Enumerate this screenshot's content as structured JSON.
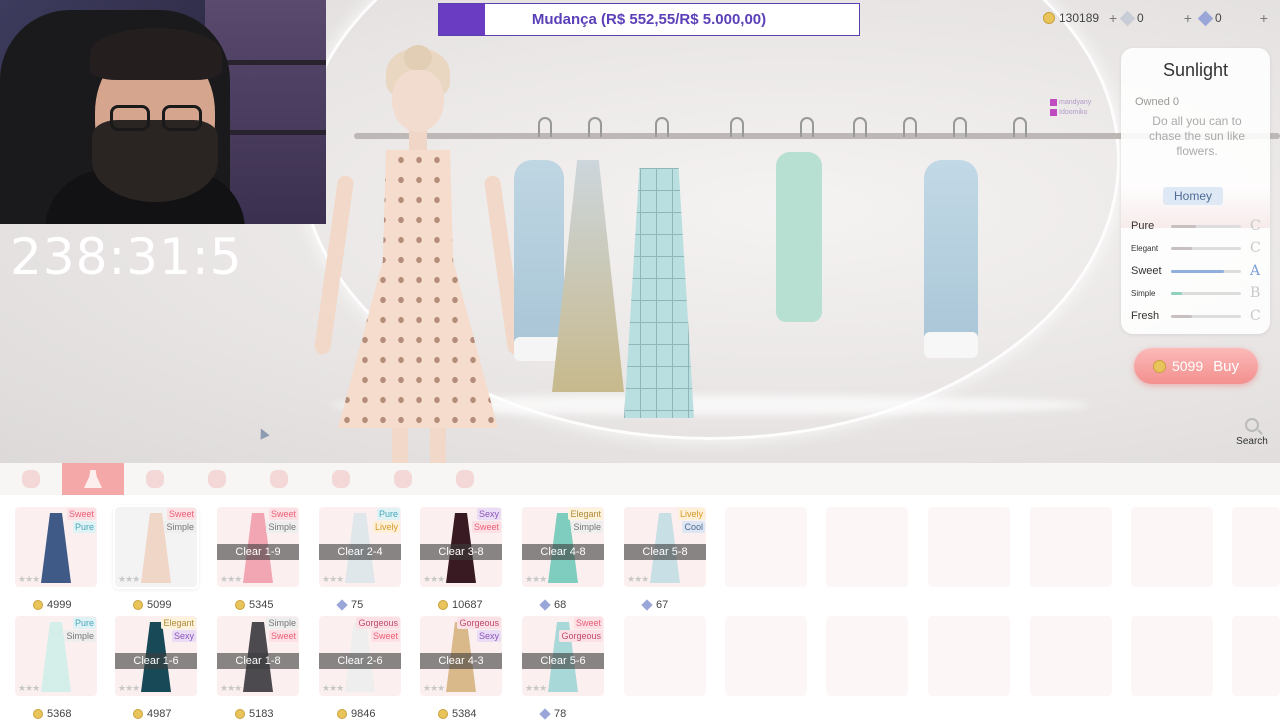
{
  "stream": {
    "timer": "238:31:5",
    "donation": {
      "label": "Mudança (R$ 552,55/R$ 5.000,00)",
      "progress": 0.1105,
      "color": "#6a3cc2"
    }
  },
  "currency": {
    "coins": "130189",
    "stamina": "0",
    "diamonds": "0"
  },
  "chat_overlay": [
    "mandyany",
    "Idoomiko"
  ],
  "card": {
    "title": "Sunlight",
    "owned": "Owned 0",
    "description": "Do all you can to chase the sun like flowers.",
    "style_tag": "Homey",
    "attributes": [
      {
        "name": "Pure",
        "grade": "C",
        "level": 0.35
      },
      {
        "name": "Elegant",
        "grade": "C",
        "level": 0.3
      },
      {
        "name": "Sweet",
        "grade": "A",
        "level": 0.75
      },
      {
        "name": "Simple",
        "grade": "B",
        "level": 0.15
      },
      {
        "name": "Fresh",
        "grade": "C",
        "level": 0.3
      }
    ]
  },
  "buy": {
    "price": "5099",
    "label": "Buy"
  },
  "search": {
    "label": "Search"
  },
  "categories": [
    "hair",
    "dress",
    "outerwear",
    "top",
    "bottom",
    "socks",
    "shoes",
    "accessory"
  ],
  "items": [
    {
      "tags": [
        "Sweet",
        "Pure"
      ],
      "clear": "",
      "price": "4999",
      "currency": "coin",
      "color": "#3f5a86",
      "selected": false
    },
    {
      "tags": [
        "Sweet",
        "Simple"
      ],
      "clear": "",
      "price": "5099",
      "currency": "coin",
      "color": "#f0d6c6",
      "selected": true
    },
    {
      "tags": [
        "Sweet",
        "Simple"
      ],
      "clear": "Clear 1-9",
      "price": "5345",
      "currency": "coin",
      "color": "#f2a5b3",
      "selected": false
    },
    {
      "tags": [
        "Pure",
        "Lively"
      ],
      "clear": "Clear 2-4",
      "price": "75",
      "currency": "diamond",
      "color": "#dfe7ea",
      "selected": false
    },
    {
      "tags": [
        "Sexy",
        "Sweet"
      ],
      "clear": "Clear 3-8",
      "price": "10687",
      "currency": "coin",
      "color": "#3a1a22",
      "selected": false
    },
    {
      "tags": [
        "Elegant",
        "Simple"
      ],
      "clear": "Clear 4-8",
      "price": "68",
      "currency": "diamond",
      "color": "#7fcdbf",
      "selected": false
    },
    {
      "tags": [
        "Lively",
        "Cool"
      ],
      "clear": "Clear 5-8",
      "price": "67",
      "currency": "diamond",
      "color": "#c9dfe6",
      "selected": false
    },
    {
      "tags": [
        "Pure",
        "Simple"
      ],
      "clear": "",
      "price": "5368",
      "currency": "coin",
      "color": "#d4eeea",
      "selected": false
    },
    {
      "tags": [
        "Elegant",
        "Sexy"
      ],
      "clear": "Clear 1-6",
      "price": "4987",
      "currency": "coin",
      "color": "#174a56",
      "selected": false
    },
    {
      "tags": [
        "Simple",
        "Sweet"
      ],
      "clear": "Clear 1-8",
      "price": "5183",
      "currency": "coin",
      "color": "#4c4a4f",
      "selected": false
    },
    {
      "tags": [
        "Gorgeous",
        "Sweet"
      ],
      "clear": "Clear 2-6",
      "price": "9846",
      "currency": "coin",
      "color": "#eeeeee",
      "selected": false
    },
    {
      "tags": [
        "Gorgeous",
        "Sexy"
      ],
      "clear": "Clear 4-3",
      "price": "5384",
      "currency": "coin",
      "color": "#d9b98a",
      "selected": false
    },
    {
      "tags": [
        "Sweet",
        "Gorgeous"
      ],
      "clear": "Clear 5-6",
      "price": "78",
      "currency": "diamond",
      "color": "#a9d8d8",
      "selected": false
    }
  ],
  "tag_colors": {
    "Sweet": [
      "#fde0e3",
      "#ea5f78"
    ],
    "Pure": [
      "#dff3f7",
      "#4aa6b8"
    ],
    "Simple": [
      "#eeeeee",
      "#777777"
    ],
    "Lively": [
      "#fdf0d6",
      "#d8982e"
    ],
    "Sexy": [
      "#eadcf5",
      "#8a56b8"
    ],
    "Elegant": [
      "#fdf2dc",
      "#b08a3a"
    ],
    "Cool": [
      "#dde6f2",
      "#4d6b93"
    ],
    "Gorgeous": [
      "#fbe1e6",
      "#c04a6a"
    ]
  }
}
